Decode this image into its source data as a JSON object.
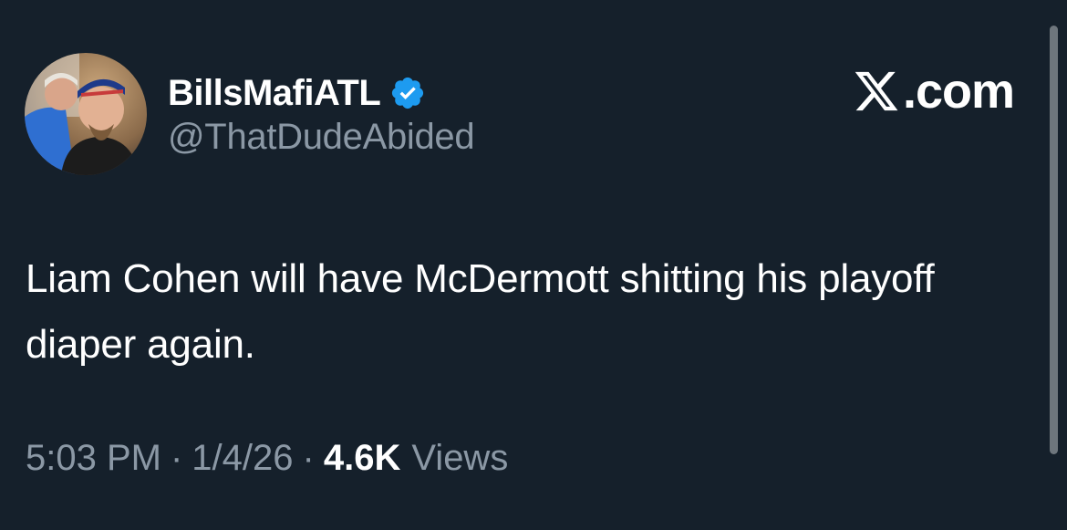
{
  "author": {
    "display_name": "BillsMafiATL",
    "handle": "@ThatDudeAbided",
    "verified": true
  },
  "brand": {
    "text": ".com",
    "logo_icon": "x-logo-icon"
  },
  "tweet": {
    "text": "Liam Cohen will have McDermott shitting his playoff diaper again."
  },
  "meta": {
    "time": "5:03 PM",
    "separator": "·",
    "date": "1/4/26",
    "views_count": "4.6K",
    "views_label": "Views"
  },
  "colors": {
    "background": "#15202b",
    "secondary_text": "#8b98a5",
    "verified_blue": "#1d9bf0"
  }
}
